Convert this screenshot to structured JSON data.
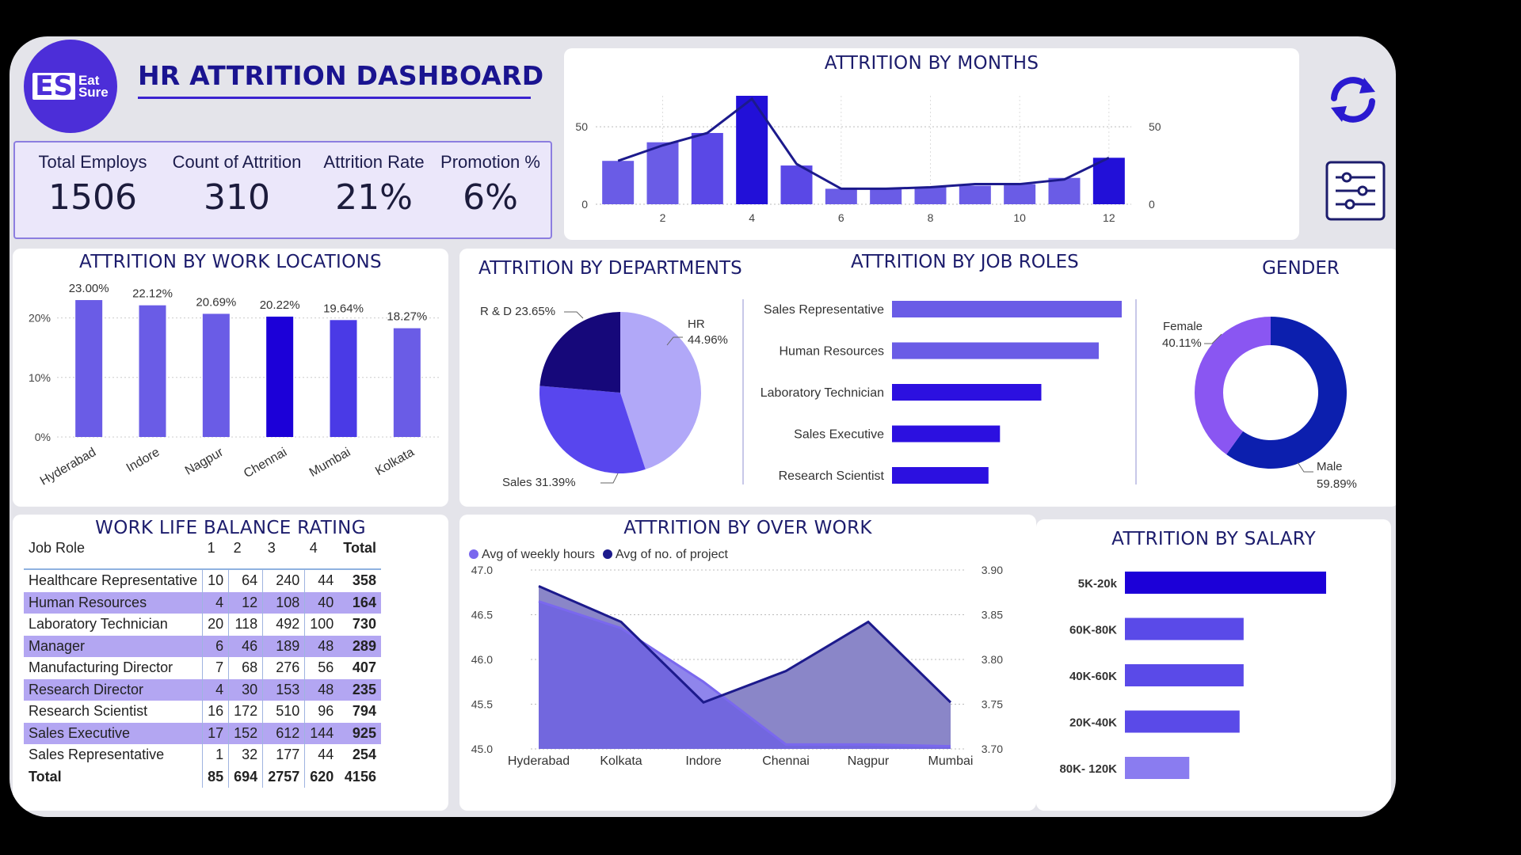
{
  "header": {
    "title": "HR ATTRITION DASHBOARD",
    "logo_line1": "Eat",
    "logo_line2": "Sure",
    "logo_mark": "ES"
  },
  "kpis": [
    {
      "label": "Total Employs",
      "value": "1506"
    },
    {
      "label": "Count of Attrition",
      "value": "310"
    },
    {
      "label": "Attrition Rate",
      "value": "21%"
    },
    {
      "label": "Promotion %",
      "value": "6%"
    }
  ],
  "icons": {
    "refresh": "refresh-icon",
    "filter": "filter-sliders-icon"
  },
  "colors": {
    "accent": "#4c2ed8",
    "dark": "#1a1490",
    "frame": "#e4e4ea"
  },
  "months": {
    "title": "ATTRITION BY MONTHS"
  },
  "locations": {
    "title": "ATTRITION BY WORK LOCATIONS"
  },
  "departments": {
    "title": "ATTRITION BY DEPARTMENTS"
  },
  "jobroles": {
    "title": "ATTRITION BY JOB ROLES"
  },
  "gender": {
    "title": "GENDER"
  },
  "wlb": {
    "title": "WORK LIFE BALANCE RATING",
    "headers": [
      "Job Role",
      "1",
      "2",
      "3",
      "4",
      "Total"
    ],
    "rows": [
      [
        "Healthcare Representative",
        "10",
        "64",
        "240",
        "44",
        "358"
      ],
      [
        "Human Resources",
        "4",
        "12",
        "108",
        "40",
        "164"
      ],
      [
        "Laboratory Technician",
        "20",
        "118",
        "492",
        "100",
        "730"
      ],
      [
        "Manager",
        "6",
        "46",
        "189",
        "48",
        "289"
      ],
      [
        "Manufacturing Director",
        "7",
        "68",
        "276",
        "56",
        "407"
      ],
      [
        "Research Director",
        "4",
        "30",
        "153",
        "48",
        "235"
      ],
      [
        "Research Scientist",
        "16",
        "172",
        "510",
        "96",
        "794"
      ],
      [
        "Sales Executive",
        "17",
        "152",
        "612",
        "144",
        "925"
      ],
      [
        "Sales Representative",
        "1",
        "32",
        "177",
        "44",
        "254"
      ]
    ],
    "total": [
      "Total",
      "85",
      "694",
      "2757",
      "620",
      "4156"
    ]
  },
  "overwork": {
    "title": "ATTRITION BY OVER WORK",
    "legend1": "Avg of weekly hours",
    "legend2": "Avg of no. of project"
  },
  "salary": {
    "title": "ATTRITION BY SALARY"
  },
  "chart_data": [
    {
      "id": "months",
      "type": "bar+line",
      "title": "ATTRITION BY MONTHS",
      "x": [
        1,
        2,
        3,
        4,
        5,
        6,
        7,
        8,
        9,
        10,
        11,
        12
      ],
      "x_ticks": [
        "2",
        "4",
        "6",
        "8",
        "10",
        "12"
      ],
      "y_ticks": [
        "0",
        "50"
      ],
      "ylim": [
        0,
        70
      ],
      "series": [
        {
          "values": [
            28,
            40,
            46,
            70,
            25,
            10,
            10,
            11,
            12,
            13,
            17,
            30
          ],
          "kind": "bar"
        },
        {
          "values": [
            28,
            38,
            46,
            68,
            26,
            10,
            10,
            11,
            13,
            13,
            16,
            30
          ],
          "kind": "line"
        }
      ],
      "grid": true
    },
    {
      "id": "locations",
      "type": "bar",
      "title": "ATTRITION BY WORK LOCATIONS",
      "categories": [
        "Hyderabad",
        "Indore",
        "Nagpur",
        "Chennai",
        "Mumbai",
        "Kolkata"
      ],
      "values": [
        23.0,
        22.12,
        20.69,
        20.22,
        19.64,
        18.27
      ],
      "data_labels": [
        "23.00%",
        "22.12%",
        "20.69%",
        "20.22%",
        "19.64%",
        "18.27%"
      ],
      "y_ticks": [
        "0%",
        "10%",
        "20%"
      ],
      "ylim": [
        0,
        25
      ],
      "colors": [
        "#6a5ce6",
        "#6a5ce6",
        "#6a5ce6",
        "#1c00d8",
        "#4a3ae6",
        "#6a5ce6"
      ]
    },
    {
      "id": "departments",
      "type": "pie",
      "title": "ATTRITION BY DEPARTMENTS",
      "categories": [
        "HR",
        "Sales",
        "R & D"
      ],
      "values": [
        44.96,
        31.39,
        23.65
      ],
      "labels": [
        "HR",
        "44.96%",
        "Sales 31.39%",
        "R & D 23.65%"
      ],
      "colors": [
        "#b1a8f8",
        "#5846ee",
        "#16087a"
      ]
    },
    {
      "id": "jobroles",
      "type": "bar",
      "orientation": "horizontal",
      "title": "ATTRITION BY JOB ROLES",
      "categories": [
        "Sales Representative",
        "Human Resources",
        "Laboratory Technician",
        "Sales Executive",
        "Research Scientist"
      ],
      "values": [
        100,
        90,
        65,
        47,
        42
      ],
      "colors": [
        "#6a5ce6",
        "#6a5ce6",
        "#2c10e0",
        "#2c10e0",
        "#2c10e0"
      ]
    },
    {
      "id": "gender",
      "type": "pie",
      "subtype": "donut",
      "title": "GENDER",
      "categories": [
        "Male",
        "Female"
      ],
      "values": [
        59.89,
        40.11
      ],
      "labels": [
        "Female",
        "40.11%",
        "Male",
        "59.89%"
      ],
      "colors": [
        "#0c1fae",
        "#8a56f2"
      ]
    },
    {
      "id": "overwork",
      "type": "area",
      "title": "ATTRITION BY OVER WORK",
      "categories": [
        "Hyderabad",
        "Kolkata",
        "Indore",
        "Chennai",
        "Nagpur",
        "Mumbai"
      ],
      "series": [
        {
          "name": "Avg of weekly hours",
          "values": [
            46.65,
            46.35,
            45.75,
            45.05,
            45.05,
            45.03
          ],
          "axis": "left"
        },
        {
          "name": "Avg of no. of project",
          "values": [
            3.882,
            3.842,
            3.752,
            3.787,
            3.842,
            3.752
          ],
          "axis": "right"
        }
      ],
      "y_left_ticks": [
        "45.0",
        "45.5",
        "46.0",
        "46.5",
        "47.0"
      ],
      "y_right_ticks": [
        "3.70",
        "3.75",
        "3.80",
        "3.85",
        "3.90"
      ],
      "ylim_left": [
        45.0,
        47.0
      ],
      "ylim_right": [
        3.7,
        3.9
      ]
    },
    {
      "id": "salary",
      "type": "bar",
      "orientation": "horizontal",
      "title": "ATTRITION BY SALARY",
      "categories": [
        "5K-20k",
        "60K-80K",
        "40K-60K",
        "20K-40K",
        "80K- 120K"
      ],
      "values": [
        100,
        59,
        59,
        57,
        32
      ],
      "colors": [
        "#1c00d8",
        "#5a4ae8",
        "#5a4ae8",
        "#5a4ae8",
        "#8a7cf0"
      ]
    }
  ]
}
